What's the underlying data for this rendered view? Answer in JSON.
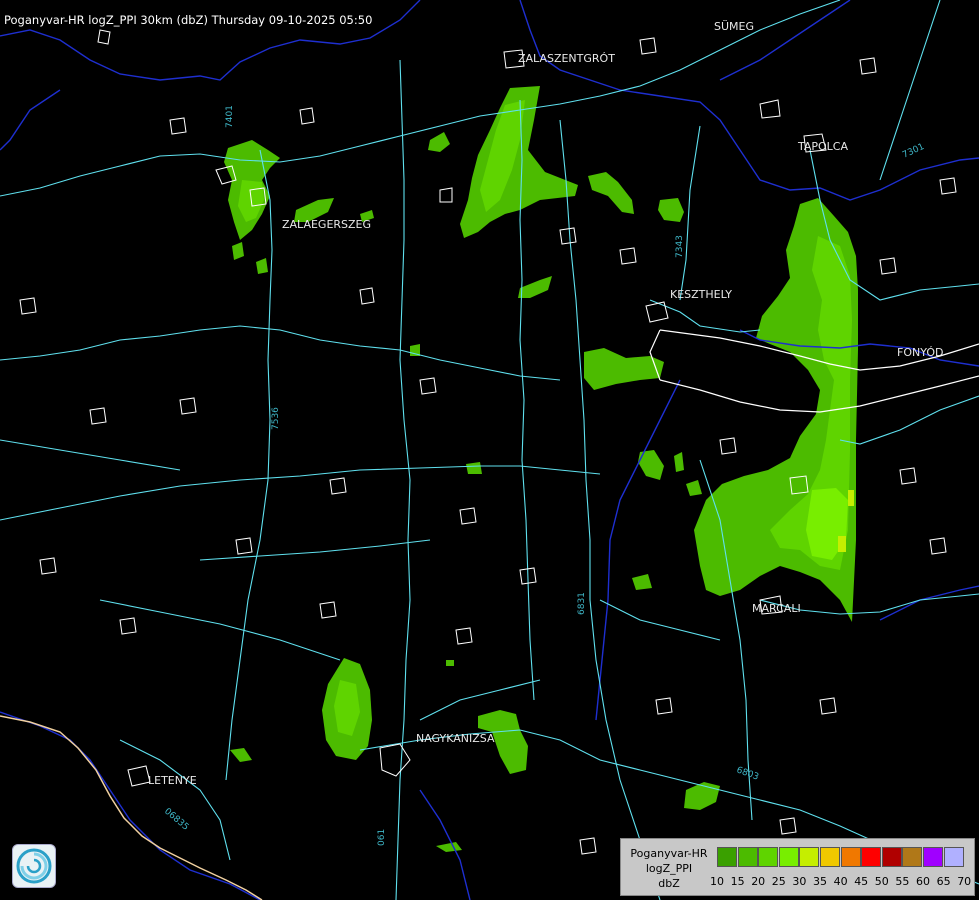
{
  "header": {
    "title": "Poganyvar-HR logZ_PPI 30km (dbZ) Thursday 09-10-2025 05:50"
  },
  "cities": [
    {
      "name": "SÜMEG"
    },
    {
      "name": "ZALASZENTGRÓT"
    },
    {
      "name": "TAPOLCA"
    },
    {
      "name": "ZALAEGERSZEG"
    },
    {
      "name": "KESZTHELY"
    },
    {
      "name": "FONYÓD"
    },
    {
      "name": "MARCALI"
    },
    {
      "name": "NAGYKANIZSA"
    },
    {
      "name": "LETENYE"
    }
  ],
  "road_labels": [
    {
      "name": "7401"
    },
    {
      "name": "7343"
    },
    {
      "name": "7301"
    },
    {
      "name": "7536"
    },
    {
      "name": "6831"
    },
    {
      "name": "6803"
    },
    {
      "name": "06835"
    },
    {
      "name": "061"
    }
  ],
  "colors": {
    "background": "#000000",
    "border": "#1e2fd0",
    "roads": "#5fe0ee",
    "settlements": "#ffffff",
    "echo_light": "#46b800",
    "echo_mid": "#5fd400",
    "echo_strong": "#80f000",
    "echo_peak": "#c8ef00"
  },
  "legend": {
    "line1": "Poganyvar-HR",
    "line2": "logZ_PPI",
    "line3": "dbZ",
    "swatches": [
      "#3aa000",
      "#4cbb00",
      "#5fd400",
      "#78ee00",
      "#c5ee00",
      "#f0c800",
      "#f07800",
      "#ff0000",
      "#b00000",
      "#b07818",
      "#a000ff",
      "#b0b0ff"
    ],
    "ticks": [
      "10",
      "15",
      "20",
      "25",
      "30",
      "35",
      "40",
      "45",
      "50",
      "55",
      "60",
      "65",
      "70"
    ]
  },
  "logo": {
    "icon": "radar-service-logo-icon"
  }
}
